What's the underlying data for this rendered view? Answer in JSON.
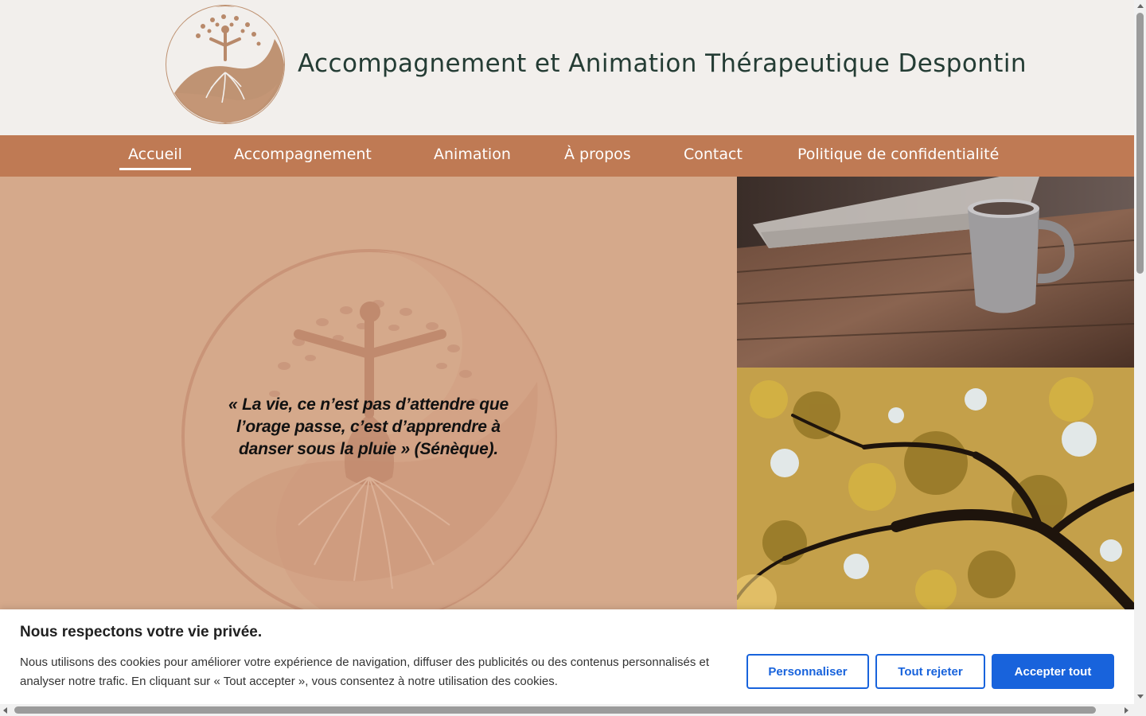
{
  "header": {
    "site_title": "Accompagnement et Animation Thérapeutique Despontin",
    "logo_icon": "tree-of-life-yin-yang-icon"
  },
  "nav": {
    "items": [
      {
        "label": "Accueil",
        "active": true
      },
      {
        "label": "Accompagnement"
      },
      {
        "label": "Animation"
      },
      {
        "label": "À propos"
      },
      {
        "label": "Contact"
      },
      {
        "label": "Politique de confidentialité"
      }
    ]
  },
  "hero": {
    "quote": "« La vie, ce n’est pas d’attendre que l’orage passe, c’est d’apprendre à danser sous la pluie » (Sénèque).",
    "background_color": "#d5a98b"
  },
  "images": {
    "coffee_alt": "coffee-mug-on-wooden-table",
    "tree_alt": "autumn-tree-canopy"
  },
  "cookie_banner": {
    "title": "Nous respectons votre vie privée.",
    "text": "Nous utilisons des cookies pour améliorer votre expérience de navigation, diffuser des publicités ou des contenus personnalisés et analyser notre trafic. En cliquant sur « Tout accepter », vous consentez à notre utilisation des cookies.",
    "customize_label": "Personnaliser",
    "reject_label": "Tout rejeter",
    "accept_label": "Accepter tout"
  },
  "colors": {
    "nav_bg": "#bf7a54",
    "header_bg": "#f2efec",
    "title_color": "#243c34",
    "accent_blue": "#1863dc"
  }
}
